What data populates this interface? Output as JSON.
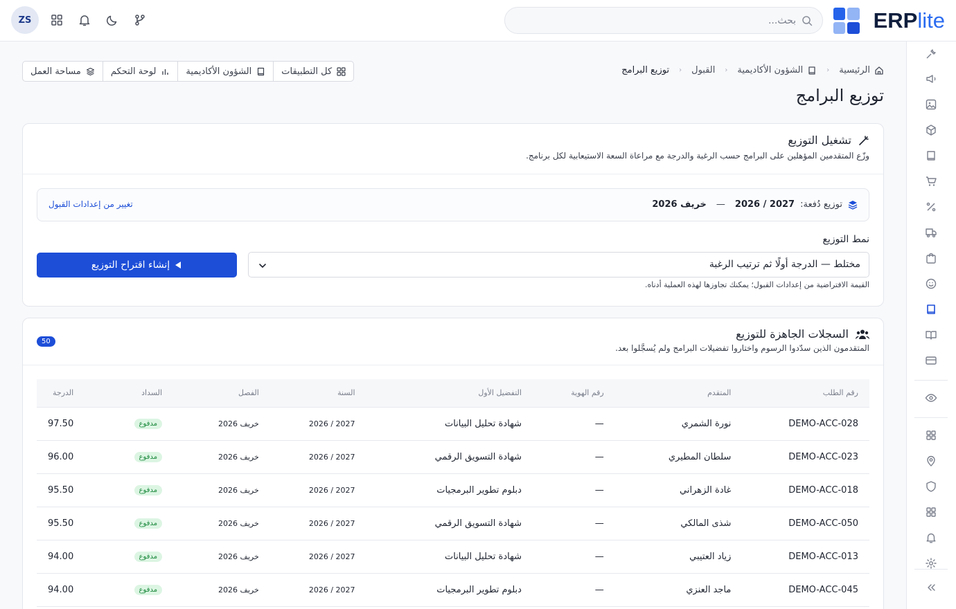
{
  "brand": {
    "erp": "ERP",
    "lite": "lite",
    "colors": [
      "#2563eb",
      "#3b82f6",
      "#93b4f5",
      "#1d4ed8"
    ]
  },
  "topbar": {
    "search_placeholder": "بحث...",
    "avatar_initials": "ZS",
    "icons": [
      "apps-grid-icon",
      "bell-icon",
      "moon-icon",
      "git-branch-icon"
    ]
  },
  "breadcrumb": [
    {
      "label": "الرئيسية",
      "icon": "home-icon"
    },
    {
      "label": "الشؤون الأكاديمية",
      "icon": "book-icon"
    },
    {
      "label": "القبول"
    },
    {
      "label": "توزيع البرامج"
    }
  ],
  "quick_links": [
    {
      "label": "كل التطبيقات",
      "icon": "apps-grid-icon"
    },
    {
      "label": "الشؤون الأكاديمية",
      "icon": "book-icon"
    },
    {
      "label": "لوحة التحكم",
      "icon": "bar-chart-icon"
    },
    {
      "label": "مساحة العمل",
      "icon": "layers-icon"
    }
  ],
  "page": {
    "title": "توزيع البرامج"
  },
  "run_card": {
    "title": "تشغيل التوزيع",
    "subtitle": "وزّع المتقدمين المؤهلين على البرامج حسب الرغبة والدرجة مع مراعاة السعة الاستيعابية لكل برنامج.",
    "cohort_label": "توزيع دُفعة:",
    "cohort_year": "2026 / 2027",
    "cohort_dash": "—",
    "cohort_term": "خريف 2026",
    "change_link": "تغيير من إعدادات القبول",
    "mode_label": "نمط التوزيع",
    "mode_value": "مختلط — الدرجة أولًا ثم ترتيب الرغبة",
    "mode_hint": "القيمة الافتراضية من إعدادات القبول؛ يمكنك تجاوزها لهذه العملية أدناه.",
    "generate_button": "إنشاء اقتراح التوزيع"
  },
  "records_card": {
    "title": "السجلات الجاهزة للتوزيع",
    "subtitle": "المتقدمون الذين سدّدوا الرسوم واختاروا تفضيلات البرامج ولم يُسجَّلوا بعد.",
    "count": "50",
    "columns": [
      "رقم الطلب",
      "المتقدم",
      "رقم الهوية",
      "التفضيل الأول",
      "السنة",
      "الفصل",
      "السداد",
      "الدرجة"
    ],
    "rows": [
      {
        "id": "DEMO-ACC-028",
        "name": "نورة الشمري",
        "nid": "—",
        "pref": "شهادة تحليل البيانات",
        "year": "2026 / 2027",
        "term": "خريف 2026",
        "paid": "مدفوع",
        "score": "97.50"
      },
      {
        "id": "DEMO-ACC-023",
        "name": "سلطان المطيري",
        "nid": "—",
        "pref": "شهادة التسويق الرقمي",
        "year": "2026 / 2027",
        "term": "خريف 2026",
        "paid": "مدفوع",
        "score": "96.00"
      },
      {
        "id": "DEMO-ACC-018",
        "name": "غادة الزهراني",
        "nid": "—",
        "pref": "دبلوم تطوير البرمجيات",
        "year": "2026 / 2027",
        "term": "خريف 2026",
        "paid": "مدفوع",
        "score": "95.50"
      },
      {
        "id": "DEMO-ACC-050",
        "name": "شذى المالكي",
        "nid": "—",
        "pref": "شهادة التسويق الرقمي",
        "year": "2026 / 2027",
        "term": "خريف 2026",
        "paid": "مدفوع",
        "score": "95.50"
      },
      {
        "id": "DEMO-ACC-013",
        "name": "زياد العتيبي",
        "nid": "—",
        "pref": "شهادة تحليل البيانات",
        "year": "2026 / 2027",
        "term": "خريف 2026",
        "paid": "مدفوع",
        "score": "94.00"
      },
      {
        "id": "DEMO-ACC-045",
        "name": "ماجد العنزي",
        "nid": "—",
        "pref": "دبلوم تطوير البرمجيات",
        "year": "2026 / 2027",
        "term": "خريف 2026",
        "paid": "مدفوع",
        "score": "94.00"
      }
    ]
  },
  "sidebar_icons": [
    "tools-icon",
    "megaphone-icon",
    "image-icon",
    "cube-icon",
    "book-icon",
    "cart-icon",
    "percent-icon",
    "truck-icon",
    "bag-icon",
    "smile-icon",
    "book-active-icon",
    "open-book-icon",
    "credit-card-icon",
    "eye-icon",
    "apps-grid-icon",
    "location-icon",
    "shield-icon",
    "apps-grid-icon",
    "bell-icon",
    "gear-icon",
    "collapse-icon"
  ],
  "accent": "#1d4ed8"
}
